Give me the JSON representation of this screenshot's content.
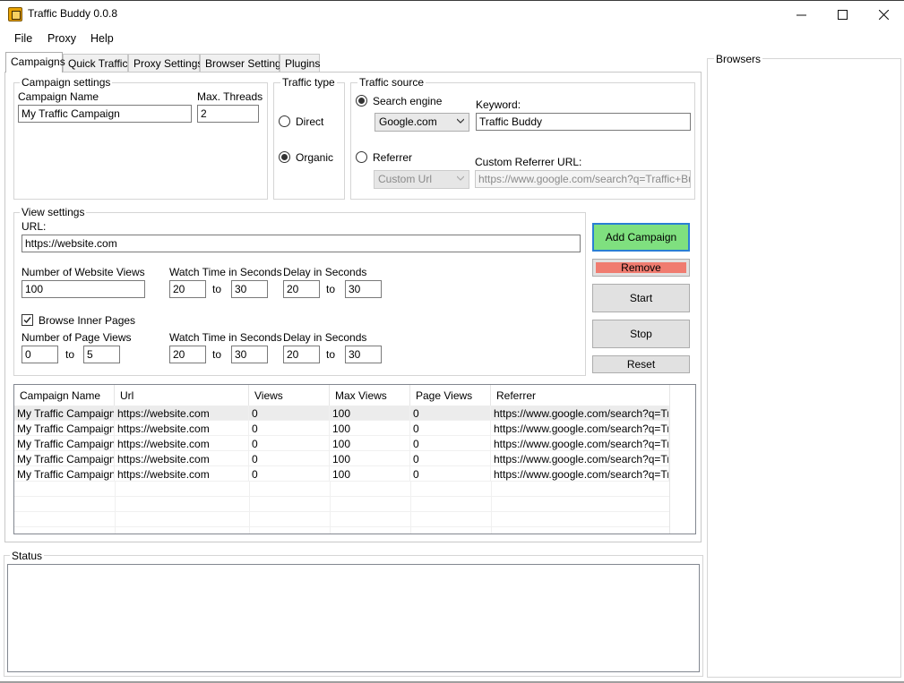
{
  "window": {
    "title": "Traffic Buddy 0.0.8"
  },
  "menu": [
    "File",
    "Proxy",
    "Help"
  ],
  "tabs": [
    "Campaigns",
    "Quick Traffic",
    "Proxy Settings",
    "Browser Settings",
    "Plugins"
  ],
  "campaign_settings": {
    "group_title": "Campaign settings",
    "name_label": "Campaign Name",
    "name_value": "My Traffic Campaign",
    "threads_label": "Max. Threads",
    "threads_value": "2"
  },
  "traffic_type": {
    "group_title": "Traffic type",
    "direct_label": "Direct",
    "organic_label": "Organic",
    "selected": "Organic"
  },
  "traffic_source": {
    "group_title": "Traffic source",
    "search_engine_label": "Search engine",
    "search_engine_value": "Google.com",
    "keyword_label": "Keyword:",
    "keyword_value": "Traffic Buddy",
    "referrer_label": "Referrer",
    "referrer_value": "Custom Url",
    "custom_referrer_label": "Custom Referrer URL:",
    "custom_referrer_value": "https://www.google.com/search?q=Traffic+Budd",
    "selected": "Search engine"
  },
  "view_settings": {
    "group_title": "View settings",
    "url_label": "URL:",
    "url_value": "https://website.com",
    "website_views_label": "Number of Website Views",
    "website_views_value": "100",
    "watch_time_label": "Watch Time in Seconds",
    "watch_from": "20",
    "watch_to": "30",
    "delay_label": "Delay in Seconds",
    "delay_from": "20",
    "delay_to": "30",
    "to_label": "to",
    "browse_inner_label": "Browse Inner Pages",
    "browse_inner_checked": true,
    "page_views_label": "Number of Page Views",
    "page_views_from": "0",
    "page_views_to": "5",
    "inner_watch_label": "Watch Time in Seconds",
    "inner_watch_from": "20",
    "inner_watch_to": "30",
    "inner_delay_label": "Delay in Seconds",
    "inner_delay_from": "20",
    "inner_delay_to": "30"
  },
  "buttons": {
    "add_campaign": "Add Campaign",
    "remove": "Remove",
    "start": "Start",
    "stop": "Stop",
    "reset": "Reset"
  },
  "grid": {
    "columns": [
      "Campaign Name",
      "Url",
      "Views",
      "Max Views",
      "Page Views",
      "Referrer"
    ],
    "rows": [
      [
        "My Traffic Campaign",
        "https://website.com",
        "0",
        "100",
        "0",
        "https://www.google.com/search?q=Tr..."
      ],
      [
        "My Traffic Campaign",
        "https://website.com",
        "0",
        "100",
        "0",
        "https://www.google.com/search?q=Tr..."
      ],
      [
        "My Traffic Campaign",
        "https://website.com",
        "0",
        "100",
        "0",
        "https://www.google.com/search?q=Tr..."
      ],
      [
        "My Traffic Campaign",
        "https://website.com",
        "0",
        "100",
        "0",
        "https://www.google.com/search?q=Tr..."
      ],
      [
        "My Traffic Campaign",
        "https://website.com",
        "0",
        "100",
        "0",
        "https://www.google.com/search?q=Tr..."
      ]
    ]
  },
  "status": {
    "group_title": "Status"
  },
  "browsers": {
    "group_title": "Browsers"
  },
  "colors": {
    "add_campaign_bg": "#7fe07f",
    "add_campaign_border": "#2a7fd4",
    "remove_bg": "#f07c70"
  }
}
